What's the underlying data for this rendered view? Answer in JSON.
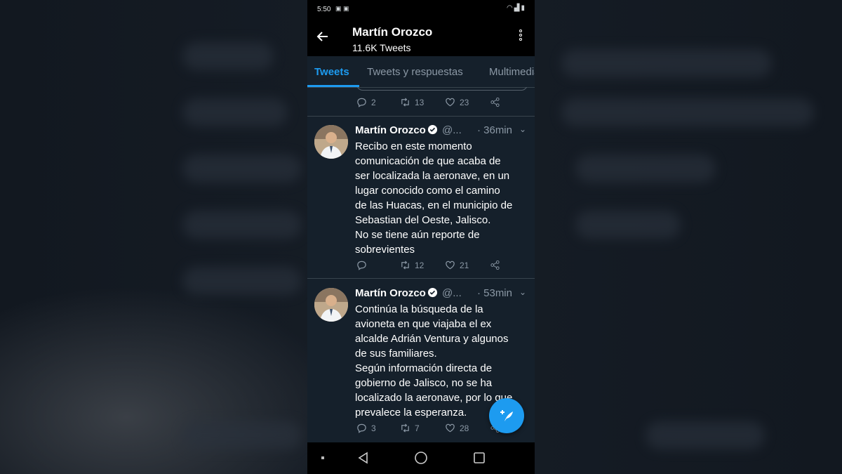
{
  "status_bar": {
    "time": "5:50",
    "notification_icons": "notification-icons",
    "right_icons": [
      "wifi-icon",
      "signal-icon",
      "battery-icon"
    ]
  },
  "header": {
    "name": "Martín Orozco",
    "tweet_count": "11.6K Tweets"
  },
  "tabs": [
    {
      "label": "Tweets",
      "active": true
    },
    {
      "label": "Tweets y respuestas",
      "active": false
    },
    {
      "label": "Multimedia",
      "active": false
    }
  ],
  "prev_tweet_actions": {
    "replies": "2",
    "retweets": "13",
    "likes": "23"
  },
  "tweets": [
    {
      "author": "Martín Orozco",
      "handle": "@...",
      "time": "· 36min",
      "text": "Recibo en este momento\ncomunicación de que acaba de\nser localizada la aeronave, en un\nlugar conocido como el camino\nde las Huacas, en el municipio de\nSebastian del Oeste, Jalisco.\nNo se tiene aún reporte de\nsobrevientes",
      "replies": "",
      "retweets": "12",
      "likes": "21"
    },
    {
      "author": "Martín Orozco",
      "handle": "@...",
      "time": "· 53min",
      "text": "Continúa la búsqueda de la\navioneta en que viajaba el ex\nalcalde Adrián Ventura y algunos\nde sus familiares.\nSegún información directa de\ngobierno de Jalisco, no se ha\nlocalizado la aeronave, por lo que\nprevalece la esperanza.",
      "replies": "3",
      "retweets": "7",
      "likes": "28"
    }
  ],
  "colors": {
    "accent": "#1d9bf0",
    "background": "#15202b",
    "muted": "#8b98a5"
  }
}
